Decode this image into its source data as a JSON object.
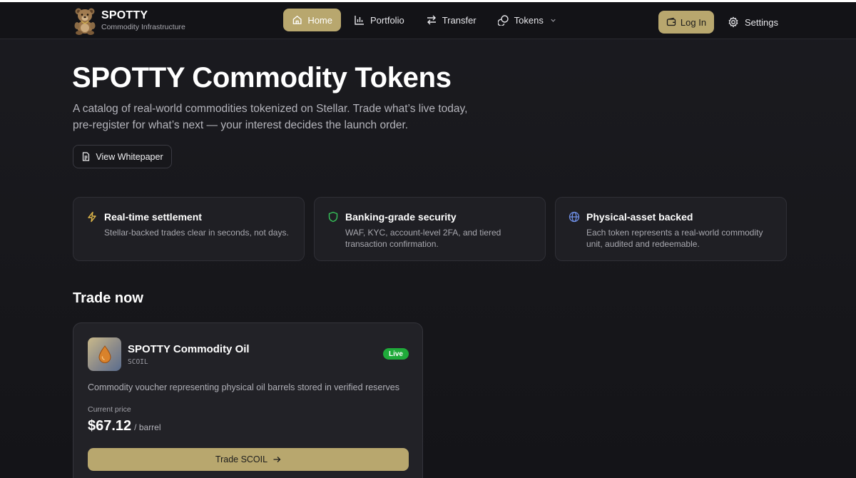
{
  "brand": {
    "name": "SPOTTY",
    "subtitle": "Commodity Infrastructure",
    "logo_icon": "teddy-bear-logo"
  },
  "nav": {
    "items": [
      {
        "label": "Home",
        "icon": "home-icon",
        "active": true
      },
      {
        "label": "Portfolio",
        "icon": "bar-chart-icon",
        "active": false
      },
      {
        "label": "Transfer",
        "icon": "arrows-swap-icon",
        "active": false
      },
      {
        "label": "Tokens",
        "icon": "coins-icon",
        "active": false,
        "has_dropdown": true
      }
    ],
    "login_label": "Log In",
    "settings_label": "Settings"
  },
  "hero": {
    "title": "SPOTTY Commodity Tokens",
    "description_line1": "A catalog of real-world commodities tokenized on Stellar. Trade what’s live today,",
    "description_line2": "pre-register for what’s next — your interest decides the launch order.",
    "whitepaper_label": "View Whitepaper"
  },
  "features": [
    {
      "icon": "lightning-icon",
      "title": "Real-time settlement",
      "description": "Stellar-backed trades clear in seconds, not days.",
      "icon_color": "#e0b84a"
    },
    {
      "icon": "shield-icon",
      "title": "Banking-grade security",
      "description": "WAF, KYC, account-level 2FA, and tiered transaction confirmation.",
      "icon_color": "#36c45a"
    },
    {
      "icon": "globe-icon",
      "title": "Physical-asset backed",
      "description": "Each token represents a real-world commodity unit, audited and redeemable.",
      "icon_color": "#6f8fe6"
    }
  ],
  "trade_now": {
    "title": "Trade now",
    "token": {
      "name": "SPOTTY Commodity Oil",
      "symbol": "SCOIL",
      "status": "Live",
      "icon": "oil-drop-icon",
      "description": "Commodity voucher representing physical oil barrels stored in verified reserves",
      "price_label": "Current price",
      "price": "$67.12",
      "unit": "/ barrel",
      "trade_label": "Trade SCOIL"
    }
  },
  "colors": {
    "accent": "#b8a76e",
    "background": "#17171b",
    "live": "#1faa3a"
  }
}
